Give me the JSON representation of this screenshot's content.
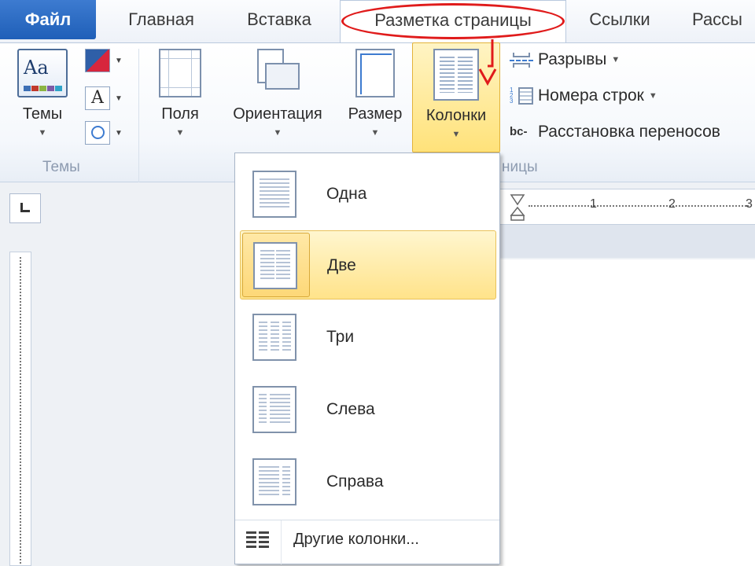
{
  "tabs": {
    "file": "Файл",
    "home": "Главная",
    "insert": "Вставка",
    "layout": "Разметка страницы",
    "links": "Ссылки",
    "mailings": "Рассы"
  },
  "ribbon": {
    "themes_group": {
      "button": "Темы",
      "label": "Темы"
    },
    "page_setup": {
      "margins": "Поля",
      "orientation": "Ориентация",
      "size": "Размер",
      "columns": "Колонки",
      "breaks": "Разрывы",
      "line_numbers": "Номера строк",
      "hyphenation": "Расстановка переносов",
      "group_label_partial": "ницы"
    }
  },
  "columns_menu": {
    "items": [
      {
        "label": "Одна",
        "icon": "one-column-icon",
        "selected": false
      },
      {
        "label": "Две",
        "icon": "two-columns-icon",
        "selected": true
      },
      {
        "label": "Три",
        "icon": "three-columns-icon",
        "selected": false
      },
      {
        "label": "Слева",
        "icon": "left-column-icon",
        "selected": false
      },
      {
        "label": "Справа",
        "icon": "right-column-icon",
        "selected": false
      }
    ],
    "more": "Другие колонки..."
  },
  "ruler": {
    "marks": [
      "1",
      "2",
      "3"
    ]
  },
  "colors": {
    "file_tab": "#2a6bc4",
    "highlight": "#ffe38a",
    "annotation": "#e01b1b"
  }
}
